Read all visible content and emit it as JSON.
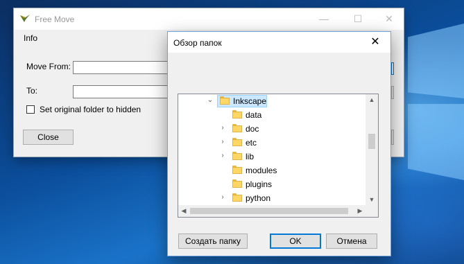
{
  "colors": {
    "selection_bg": "#cce8ff",
    "selection_border": "#99d1ff",
    "default_button_border": "#0078d7",
    "folder_yellow": "#ffd766"
  },
  "free_move": {
    "title": "Free Move",
    "app_icon": "free-move-app-icon",
    "caption": {
      "minimize": "—",
      "maximize": "☐",
      "close": "✕"
    },
    "menu": {
      "info": "Info"
    },
    "move_from_label": "Move From:",
    "move_from_value": "",
    "to_label": "To:",
    "to_value": "",
    "hidden_checkbox_label": "Set original folder to hidden",
    "hidden_checkbox_checked": false,
    "close_button": "Close"
  },
  "browse_dialog": {
    "title": "Обзор папок",
    "close_glyph": "✕",
    "tree": [
      {
        "label": "Inkscape",
        "expander": "expanded",
        "selected": true
      },
      {
        "label": "data",
        "expander": "none",
        "selected": false
      },
      {
        "label": "doc",
        "expander": "collapsed",
        "selected": false
      },
      {
        "label": "etc",
        "expander": "collapsed",
        "selected": false
      },
      {
        "label": "lib",
        "expander": "collapsed",
        "selected": false
      },
      {
        "label": "modules",
        "expander": "none",
        "selected": false
      },
      {
        "label": "plugins",
        "expander": "none",
        "selected": false
      },
      {
        "label": "python",
        "expander": "collapsed",
        "selected": false
      }
    ],
    "scroll": {
      "up": "▲",
      "down": "▼",
      "left": "◀",
      "right": "▶"
    },
    "buttons": {
      "new_folder": "Создать папку",
      "ok": "OK",
      "cancel": "Отмена"
    }
  }
}
